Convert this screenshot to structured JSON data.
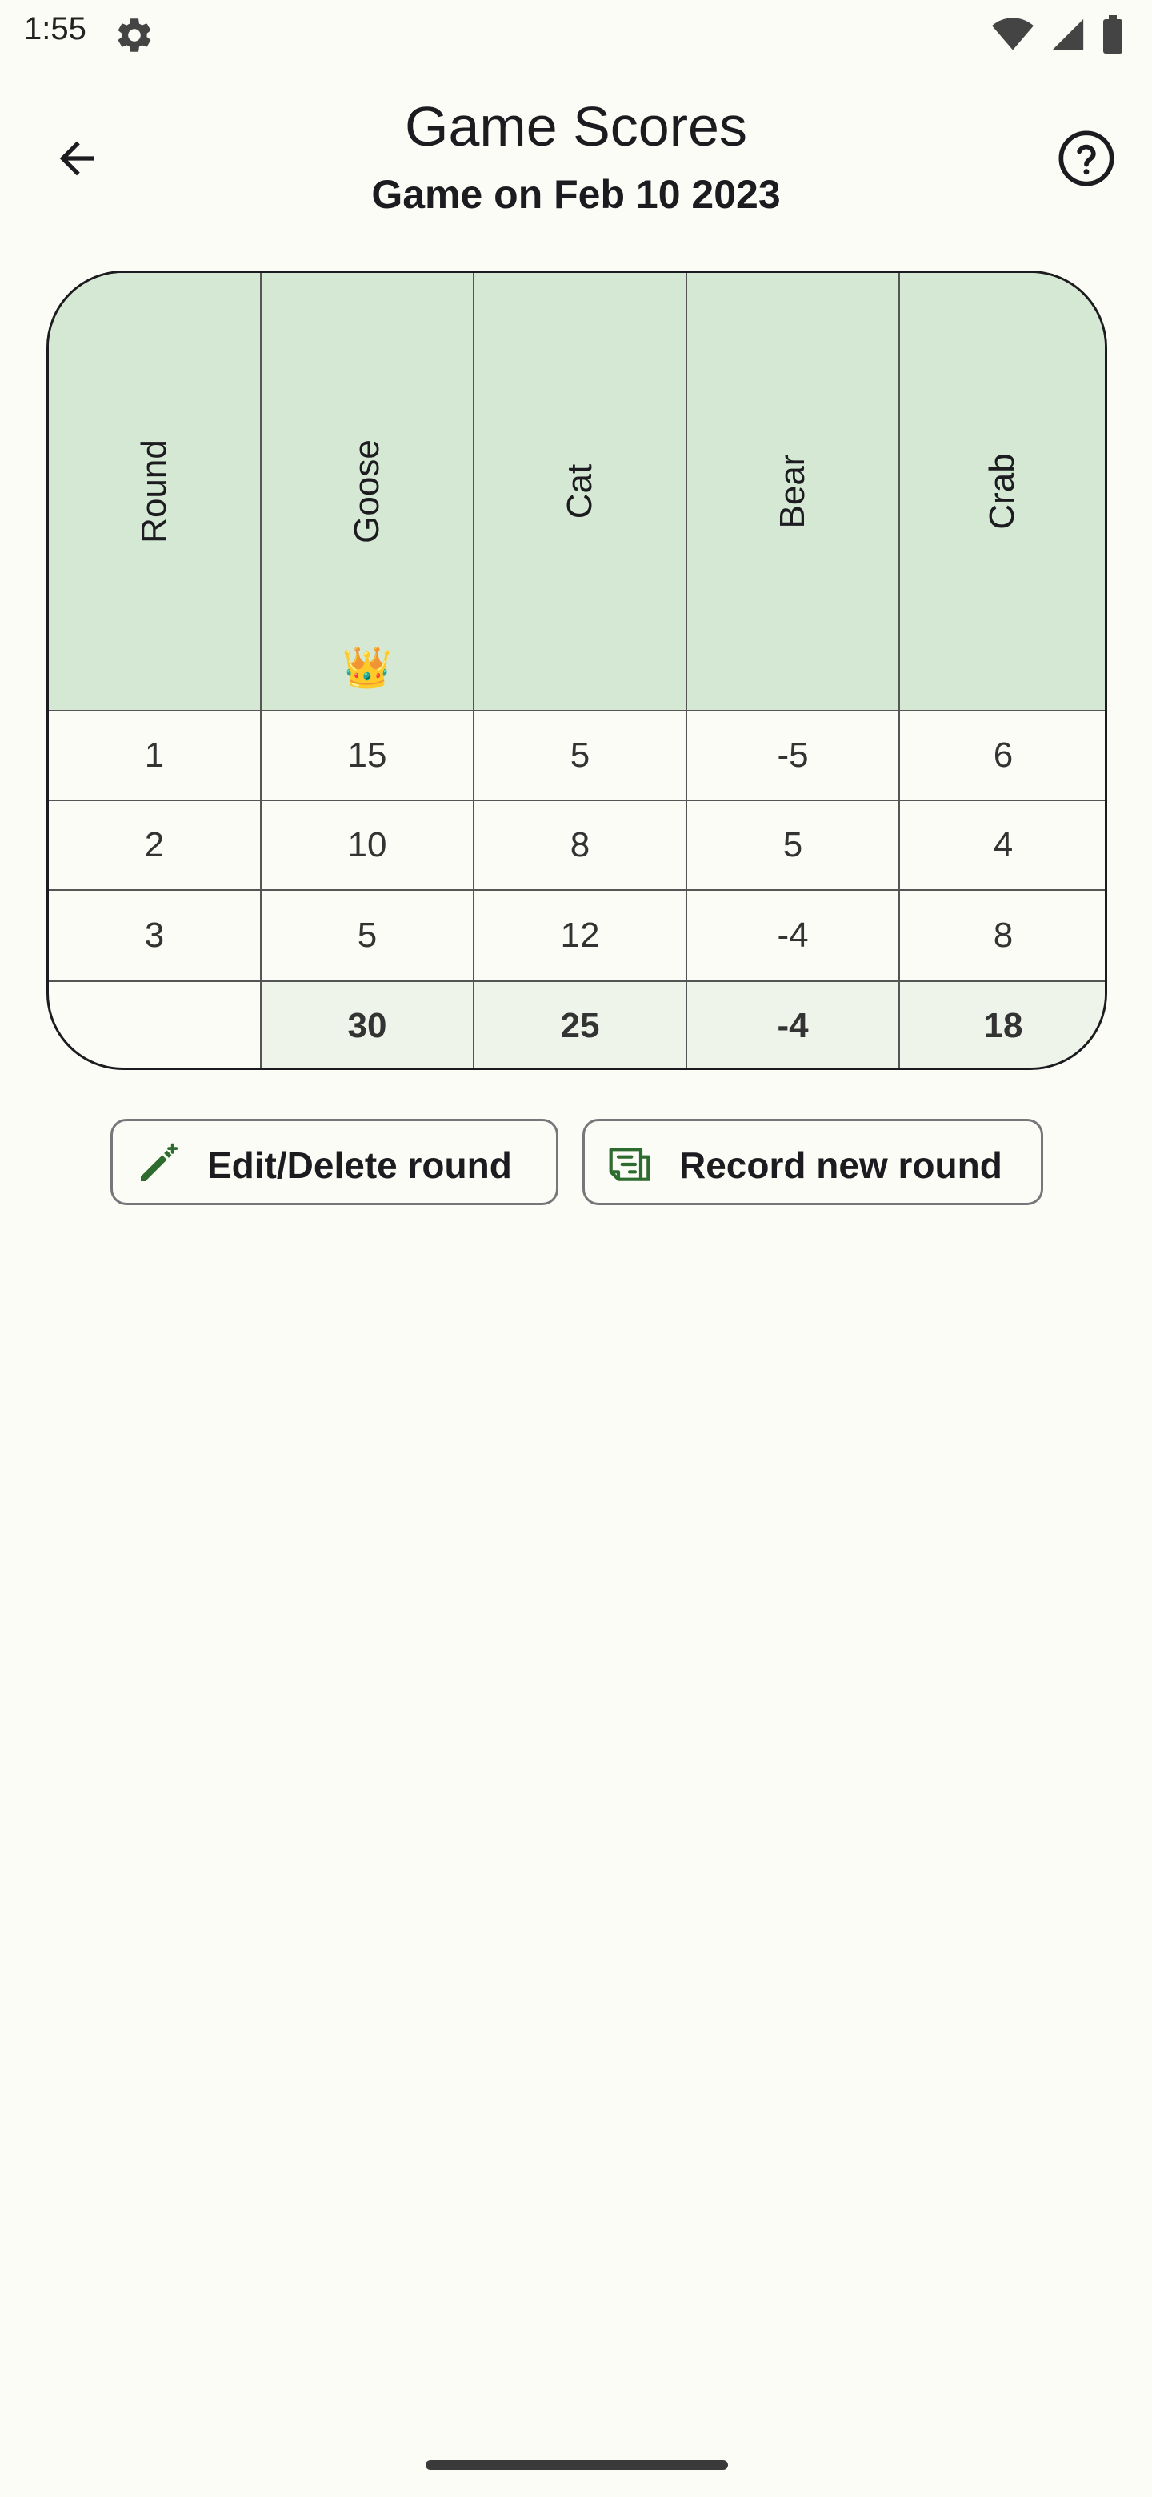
{
  "status_bar": {
    "time": "1:55",
    "icons": [
      "gear-icon",
      "wifi-icon",
      "signal-icon",
      "battery-icon"
    ]
  },
  "app_bar": {
    "title": "Game Scores",
    "subtitle": "Game on Feb 10 2023",
    "back_icon": "arrow-back-icon",
    "help_icon": "help-circle-icon"
  },
  "scores": {
    "headers": [
      "Round",
      "Goose",
      "Cat",
      "Bear",
      "Crab"
    ],
    "leader_badge": "👑",
    "rows": [
      [
        "1",
        "15",
        "5",
        "-5",
        "6"
      ],
      [
        "2",
        "10",
        "8",
        "5",
        "4"
      ],
      [
        "3",
        "5",
        "12",
        "-4",
        "8"
      ]
    ],
    "totals": [
      "",
      "30",
      "25",
      "-4",
      "18"
    ]
  },
  "actions": {
    "edit_label": "Edit/Delete round",
    "record_label": "Record new round"
  },
  "colors": {
    "background": "#fcfcf6",
    "header_bg": "#d4e8d4",
    "totals_bg": "#eef4ea",
    "accent_icon": "#2e6b2e"
  }
}
